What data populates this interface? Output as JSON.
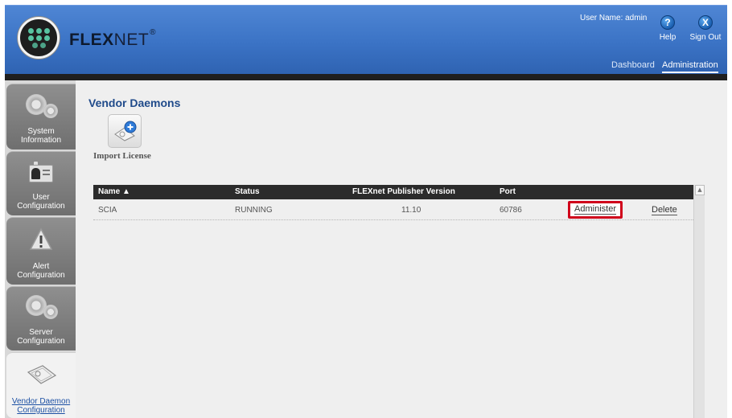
{
  "header": {
    "brand_bold": "FLEX",
    "brand_light": "NET",
    "brand_mark": "®",
    "user_name": "User Name: admin",
    "help": {
      "icon": "help-icon",
      "glyph": "?",
      "label": "Help"
    },
    "signout": {
      "icon": "signout-icon",
      "glyph": "X",
      "label": "Sign Out"
    },
    "nav": [
      {
        "label": "Dashboard",
        "active": false
      },
      {
        "label": "Administration",
        "active": true
      }
    ]
  },
  "sidebar": {
    "items": [
      {
        "line1": "System",
        "line2": "Information",
        "icon": "gears-icon"
      },
      {
        "line1": "User",
        "line2": "Configuration",
        "icon": "user-badge-icon"
      },
      {
        "line1": "Alert",
        "line2": "Configuration",
        "icon": "warning-icon"
      },
      {
        "line1": "Server",
        "line2": "Configuration",
        "icon": "gears-icon"
      },
      {
        "line1": "Vendor Daemon",
        "line2": "Configuration",
        "icon": "license-certificate-icon",
        "active": true
      }
    ]
  },
  "main": {
    "title": "Vendor Daemons",
    "import_label": "Import License",
    "table": {
      "headers": [
        "Name ▲",
        "Status",
        "FLEXnet Publisher Version",
        "Port"
      ],
      "rows": [
        {
          "name": "SCIA",
          "status": "RUNNING",
          "version": "11.10",
          "port": "60786",
          "administer": "Administer",
          "delete": "Delete"
        }
      ]
    },
    "scroll_up": "▲"
  },
  "colors": {
    "header_blue": "#3b73c5",
    "title_blue": "#1f4a8a",
    "highlight_red": "#d0021b",
    "logo_green": "#58c3a1"
  }
}
